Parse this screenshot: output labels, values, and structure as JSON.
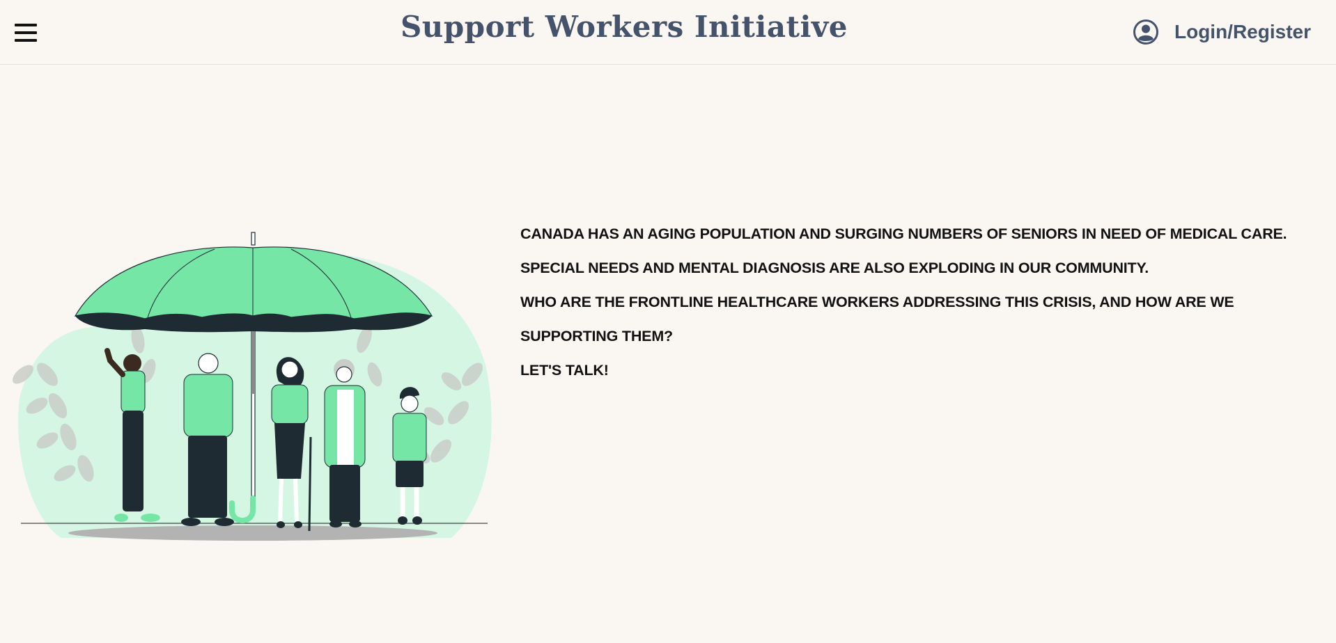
{
  "header": {
    "menu_icon": "hamburger-menu-icon",
    "title": "Support Workers Initiative",
    "login_icon": "user-circle-icon",
    "login_label": "Login/Register"
  },
  "hero": {
    "illustration": "people-under-umbrella-illustration",
    "paragraphs": [
      "CANADA HAS AN AGING POPULATION AND SURGING NUMBERS OF SENIORS IN NEED OF MEDICAL CARE.",
      "SPECIAL NEEDS AND MENTAL DIAGNOSIS ARE ALSO EXPLODING IN OUR COMMUNITY.",
      "WHO ARE THE FRONTLINE HEALTHCARE WORKERS ADDRESSING THIS CRISIS, AND HOW ARE WE SUPPORTING THEM?",
      "LET'S TALK!"
    ]
  },
  "colors": {
    "background": "#faf7f3",
    "title": "#44536b",
    "accent_green": "#76e6a6",
    "light_green": "#d4f6e3",
    "dark": "#1f2b33",
    "text": "#111111"
  }
}
